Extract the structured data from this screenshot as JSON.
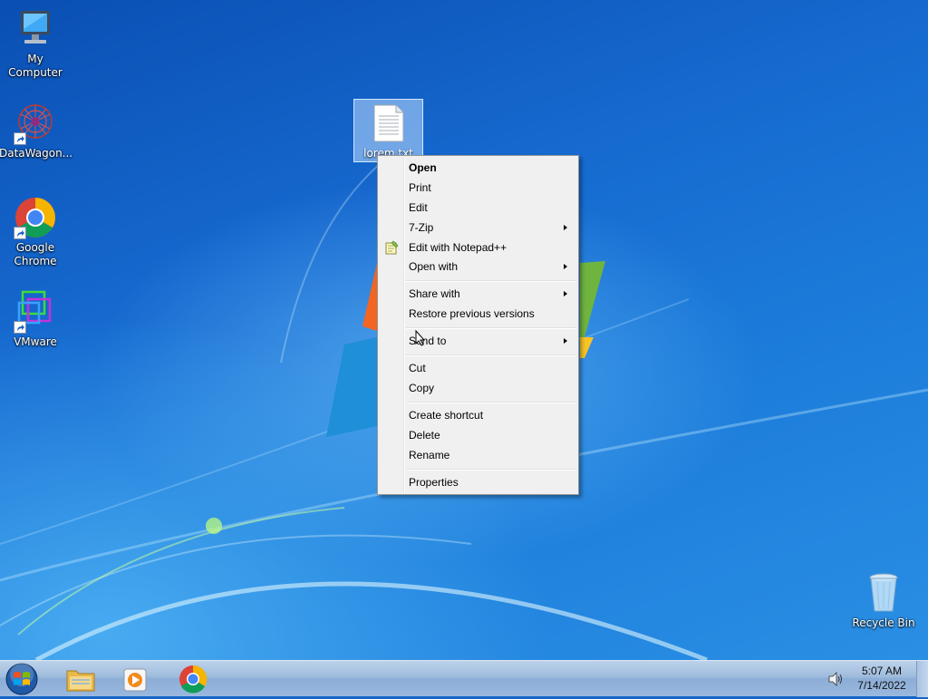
{
  "desktop_icons": [
    {
      "name": "my-computer",
      "label": "My Computer",
      "icon": "computer-icon"
    },
    {
      "name": "datawagon",
      "label": "DataWagon...",
      "icon": "datawagon-icon"
    },
    {
      "name": "google-chrome",
      "label": "Google Chrome",
      "icon": "chrome-icon"
    },
    {
      "name": "vmware",
      "label": "VMware",
      "icon": "vmware-icon"
    },
    {
      "name": "recycle-bin",
      "label": "Recycle Bin",
      "icon": "recycle-bin-icon"
    }
  ],
  "selected_file": {
    "label": "lorem.txt",
    "icon": "text-file-icon"
  },
  "context_menu": {
    "items": [
      {
        "label": "Open",
        "bold": true
      },
      {
        "label": "Print"
      },
      {
        "label": "Edit"
      },
      {
        "label": "7-Zip",
        "submenu": true
      },
      {
        "label": "Edit with Notepad++",
        "icon": "notepad-plus-icon"
      },
      {
        "label": "Open with",
        "submenu": true
      },
      {
        "label": "Share with",
        "submenu": true
      },
      {
        "label": "Restore previous versions"
      },
      {
        "label": "Send to",
        "submenu": true
      },
      {
        "label": "Cut"
      },
      {
        "label": "Copy"
      },
      {
        "label": "Create shortcut"
      },
      {
        "label": "Delete"
      },
      {
        "label": "Rename"
      },
      {
        "label": "Properties"
      }
    ]
  },
  "taskbar": {
    "start_icon": "windows-orb-icon",
    "pinned": [
      {
        "name": "explorer",
        "icon": "folder-icon"
      },
      {
        "name": "media-player",
        "icon": "media-player-icon"
      },
      {
        "name": "chrome",
        "icon": "chrome-icon"
      }
    ],
    "clock": {
      "time": "5:07 AM",
      "date": "7/14/2022"
    }
  },
  "colors": {
    "desktop": "#1669cf",
    "menu_bg": "#f0f0f0",
    "taskbar": "#9fbbdc"
  }
}
